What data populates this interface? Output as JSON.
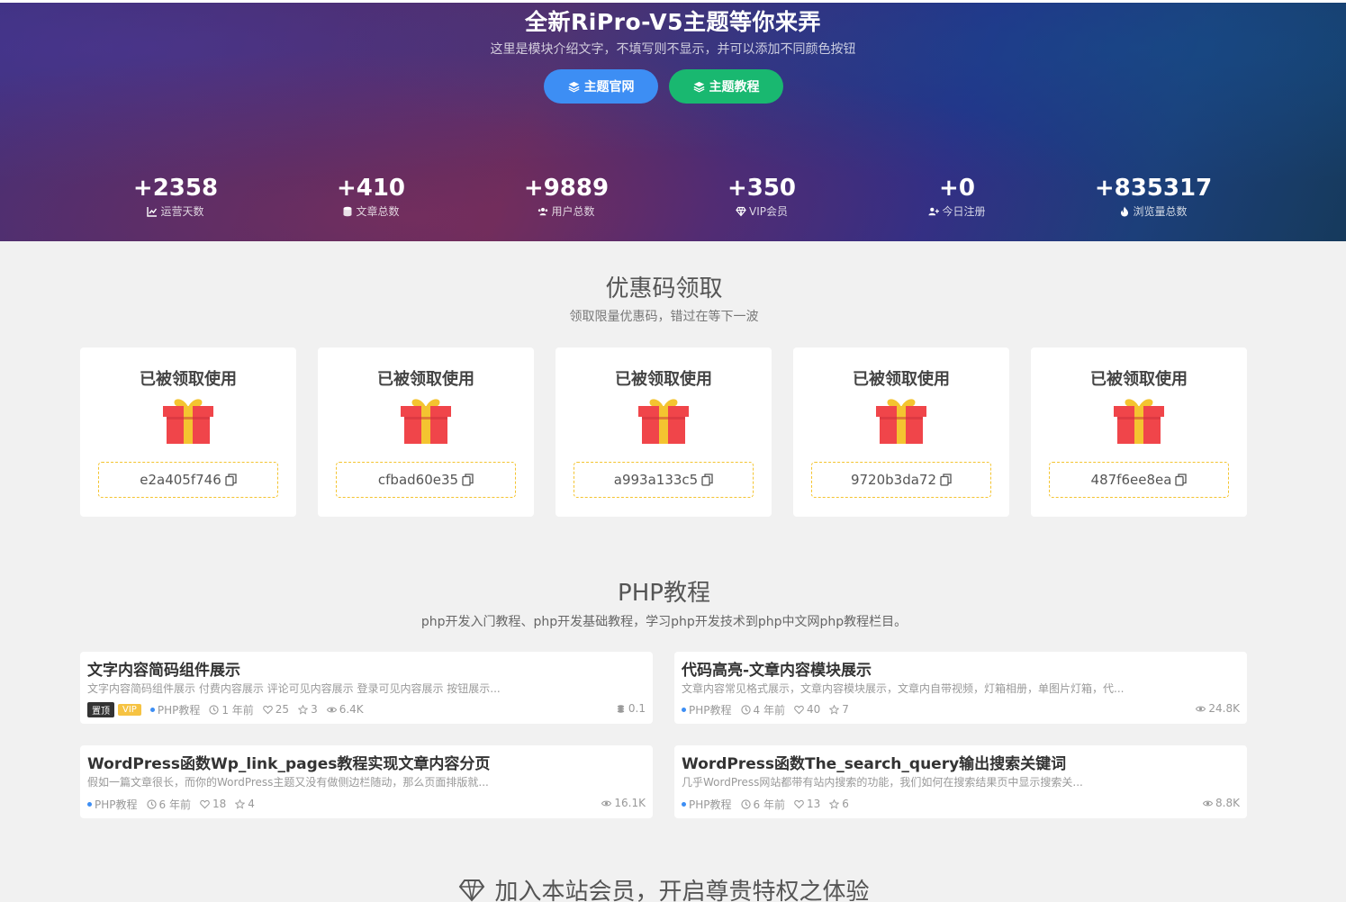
{
  "hero": {
    "title": "全新RiPro-V5主题等你来弄",
    "description": "这里是模块介绍文字，不填写则不显示，并可以添加不同颜色按钮",
    "buttons": [
      {
        "label": "主题官网",
        "color": "#3d8ef4",
        "icon": "layers-icon"
      },
      {
        "label": "主题教程",
        "color": "#19b870",
        "icon": "layers-icon"
      }
    ],
    "stats": [
      {
        "value": "+2358",
        "label": "运营天数",
        "icon": "chart-line-icon"
      },
      {
        "value": "+410",
        "label": "文章总数",
        "icon": "database-icon"
      },
      {
        "value": "+9889",
        "label": "用户总数",
        "icon": "users-icon"
      },
      {
        "value": "+350",
        "label": "VIP会员",
        "icon": "diamond-icon"
      },
      {
        "value": "+0",
        "label": "今日注册",
        "icon": "user-plus-icon"
      },
      {
        "value": "+835317",
        "label": "浏览量总数",
        "icon": "fire-icon"
      }
    ]
  },
  "coupons": {
    "title": "优惠码领取",
    "subtitle": "领取限量优惠码，错过在等下一波",
    "items": [
      {
        "status": "已被领取使用",
        "code": "e2a405f746"
      },
      {
        "status": "已被领取使用",
        "code": "cfbad60e35"
      },
      {
        "status": "已被领取使用",
        "code": "a993a133c5"
      },
      {
        "status": "已被领取使用",
        "code": "9720b3da72"
      },
      {
        "status": "已被领取使用",
        "code": "487f6ee8ea"
      }
    ]
  },
  "php": {
    "title": "PHP教程",
    "subtitle": "php开发入门教程、php开发基础教程，学习php开发技术到php中文网php教程栏目。",
    "articles": [
      {
        "title": "文字内容简码组件展示",
        "excerpt": "文字内容简码组件展示 付费内容展示 评论可见内容展示 登录可见内容展示 按钮展示...",
        "badge_top": "置顶",
        "badge_vip": "VIP",
        "category": "PHP教程",
        "time": "1 年前",
        "likes": "25",
        "stars": "3",
        "views": "6.4K",
        "right": "0.1"
      },
      {
        "title": "代码高亮-文章内容模块展示",
        "excerpt": "文章内容常见格式展示，文章内容模块展示，文章内自带视频，灯箱相册，单图片灯箱，代...",
        "category": "PHP教程",
        "time": "4 年前",
        "likes": "40",
        "stars": "7",
        "right": "24.8K"
      },
      {
        "title": "WordPress函数Wp_link_pages教程实现文章内容分页",
        "excerpt": "假如一篇文章很长，而你的WordPress主题又没有做侧边栏随动，那么页面排版就...",
        "category": "PHP教程",
        "time": "6 年前",
        "likes": "18",
        "stars": "4",
        "right": "16.1K"
      },
      {
        "title": "WordPress函数The_search_query输出搜索关键词",
        "excerpt": "几乎WordPress网站都带有站内搜索的功能，我们如何在搜索结果页中显示搜索关...",
        "category": "PHP教程",
        "time": "6 年前",
        "likes": "13",
        "stars": "6",
        "right": "8.8K"
      }
    ]
  },
  "vip": {
    "title": "加入本站会员，开启尊贵特权之体验"
  }
}
